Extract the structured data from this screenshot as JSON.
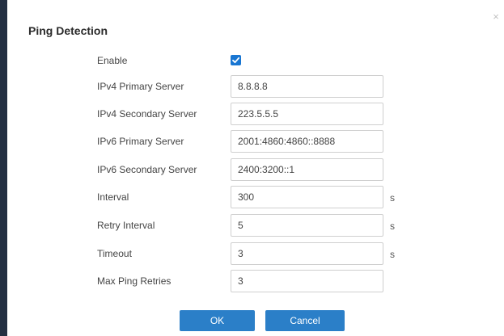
{
  "dialog": {
    "title": "Ping Detection",
    "close_glyph": "×"
  },
  "fields": {
    "enable": {
      "label": "Enable",
      "checked": true
    },
    "ipv4_primary": {
      "label": "IPv4 Primary Server",
      "value": "8.8.8.8"
    },
    "ipv4_secondary": {
      "label": "IPv4 Secondary Server",
      "value": "223.5.5.5"
    },
    "ipv6_primary": {
      "label": "IPv6 Primary Server",
      "value": "2001:4860:4860::8888"
    },
    "ipv6_secondary": {
      "label": "IPv6 Secondary Server",
      "value": "2400:3200::1"
    },
    "interval": {
      "label": "Interval",
      "value": "300",
      "unit": "s"
    },
    "retry_interval": {
      "label": "Retry Interval",
      "value": "5",
      "unit": "s"
    },
    "timeout": {
      "label": "Timeout",
      "value": "3",
      "unit": "s"
    },
    "max_ping_retries": {
      "label": "Max Ping Retries",
      "value": "3"
    }
  },
  "buttons": {
    "ok_label": "OK",
    "cancel_label": "Cancel"
  },
  "colors": {
    "accent": "#2b7fc8",
    "checkbox": "#1976d2",
    "backdrop": "#243042"
  },
  "icons": {
    "close": "close-icon",
    "check": "checkmark-icon"
  }
}
